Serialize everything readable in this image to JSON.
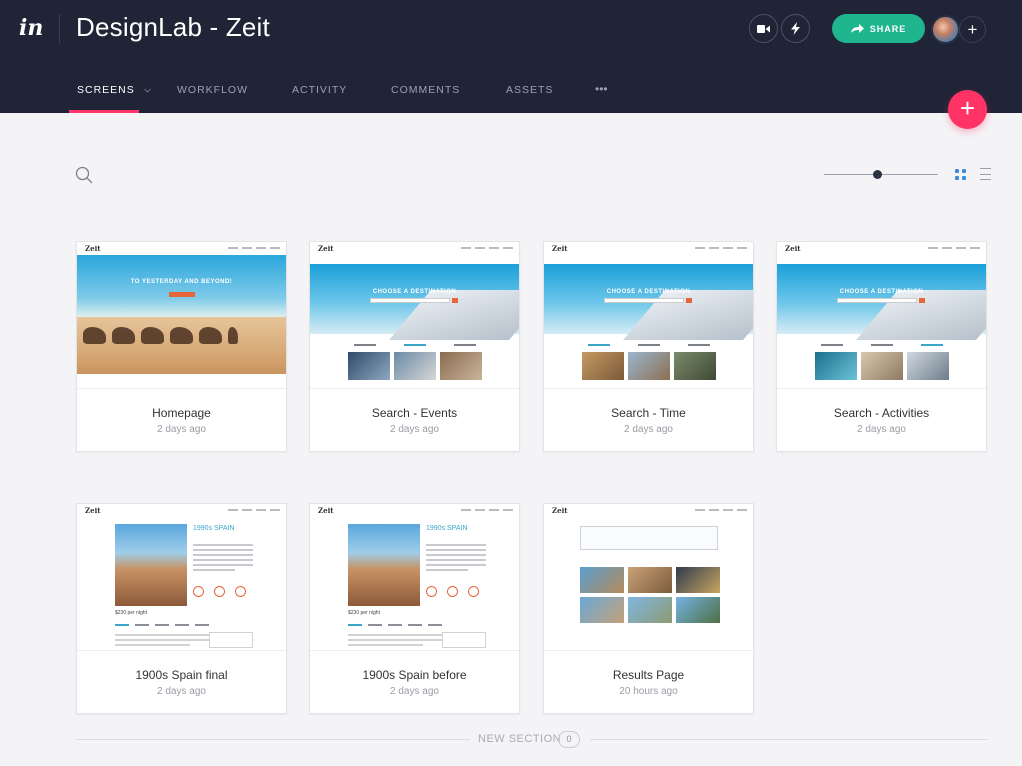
{
  "app": {
    "project_title": "DesignLab - Zeit",
    "share_label": "SHARE",
    "add_collaborator": "+",
    "fab_label": "+"
  },
  "tabs": [
    {
      "label": "SCREENS",
      "active": true,
      "has_dropdown": true
    },
    {
      "label": "WORKFLOW",
      "active": false
    },
    {
      "label": "ACTIVITY",
      "active": false
    },
    {
      "label": "COMMENTS",
      "active": false
    },
    {
      "label": "ASSETS",
      "active": false
    },
    {
      "label": "•••",
      "active": false
    }
  ],
  "toolbar": {
    "view_mode": "grid",
    "zoom_level": 0.48
  },
  "screens": [
    {
      "title": "Homepage",
      "time": "2 days ago",
      "thumb": "homepage"
    },
    {
      "title": "Search - Events",
      "time": "2 days ago",
      "thumb": "search"
    },
    {
      "title": "Search - Time",
      "time": "2 days ago",
      "thumb": "search"
    },
    {
      "title": "Search - Activities",
      "time": "2 days ago",
      "thumb": "search"
    },
    {
      "title": "1900s Spain final",
      "time": "2 days ago",
      "thumb": "detail"
    },
    {
      "title": "1900s Spain before",
      "time": "2 days ago",
      "thumb": "detail"
    },
    {
      "title": "Results Page",
      "time": "20 hours ago",
      "thumb": "results"
    }
  ],
  "new_section": {
    "label": "NEW SECTION",
    "count": "0"
  },
  "colors": {
    "header_bg": "#1f2436",
    "accent_pink": "#ff3366",
    "share_green": "#1fb58f",
    "active_view_blue": "#3c8fd6"
  },
  "icons": {
    "logo": "invision-logo-icon",
    "video": "video-camera-icon",
    "lightning": "lightning-icon",
    "share": "share-arrow-icon",
    "search": "search-icon",
    "grid": "grid-view-icon",
    "list": "list-view-icon"
  }
}
